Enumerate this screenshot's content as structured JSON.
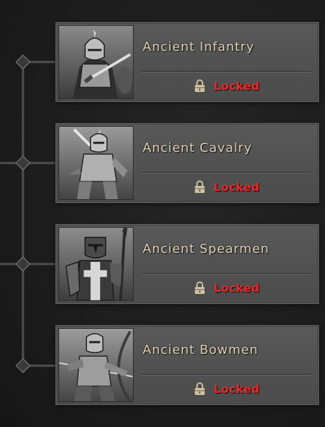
{
  "colors": {
    "background": "#1e1e1e",
    "card": "#555555",
    "title_text": "#e2d3b8",
    "locked_text": "#e8282a",
    "connector": "#555555"
  },
  "units": [
    {
      "name": "Ancient Infantry",
      "status": "Locked",
      "portrait": "knight-with-sword"
    },
    {
      "name": "Ancient Cavalry",
      "status": "Locked",
      "portrait": "knight-raising-sword"
    },
    {
      "name": "Ancient Spearmen",
      "status": "Locked",
      "portrait": "knight-with-shield"
    },
    {
      "name": "Ancient Bowmen",
      "status": "Locked",
      "portrait": "archer-drawing-bow"
    }
  ],
  "status_icon": "padlock-icon"
}
